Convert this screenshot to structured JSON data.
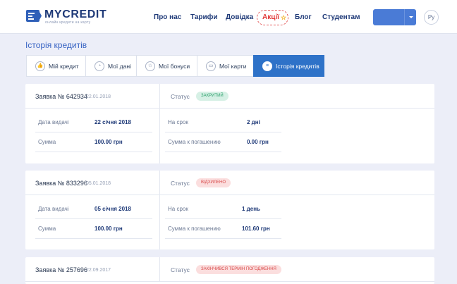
{
  "logo": {
    "title": "MYCREDIT",
    "subtitle": "онлайн кредити на карту"
  },
  "nav": {
    "about": "Про нас",
    "tariffs": "Тарифи",
    "help": "Довідка",
    "promo": "Акції",
    "blog": "Блог",
    "students": "Студентам"
  },
  "header": {
    "lang": "Ру",
    "accent": "#4a7bd6"
  },
  "page_title": "Історія кредитів",
  "tabs": [
    {
      "label": "Мій кредит",
      "icon": "thumbs-up-icon"
    },
    {
      "label": "Мої дані",
      "icon": "user-icon"
    },
    {
      "label": "Мої бонуси",
      "icon": "star-icon"
    },
    {
      "label": "Мої карти",
      "icon": "card-icon"
    },
    {
      "label": "Історія кредитів",
      "icon": "list-icon"
    }
  ],
  "labels": {
    "status": "Статус",
    "issue_date": "Дата видачі",
    "term": "На срок",
    "amount": "Сумма",
    "repay_amount": "Сумма к погашению"
  },
  "loans": [
    {
      "number": "Заявка № 642934",
      "date": "22.01.2018",
      "status": "ЗАКРИТИЙ",
      "issue_date": "22 січня 2018",
      "term": "2 дні",
      "amount": "100.00 грн",
      "repay": "0.00 грн"
    },
    {
      "number": "Заявка № 833296",
      "date": "05.01.2018",
      "status": "ВІДХИЛЕНО",
      "issue_date": "05 січня 2018",
      "term": "1 день",
      "amount": "100.00 грн",
      "repay": "101.60 грн"
    },
    {
      "number": "Заявка № 257696",
      "date": "22.09.2017",
      "status": "ЗАКІНЧИВСЯ ТЕРМІН ПОГОДЖЕННЯ"
    }
  ]
}
